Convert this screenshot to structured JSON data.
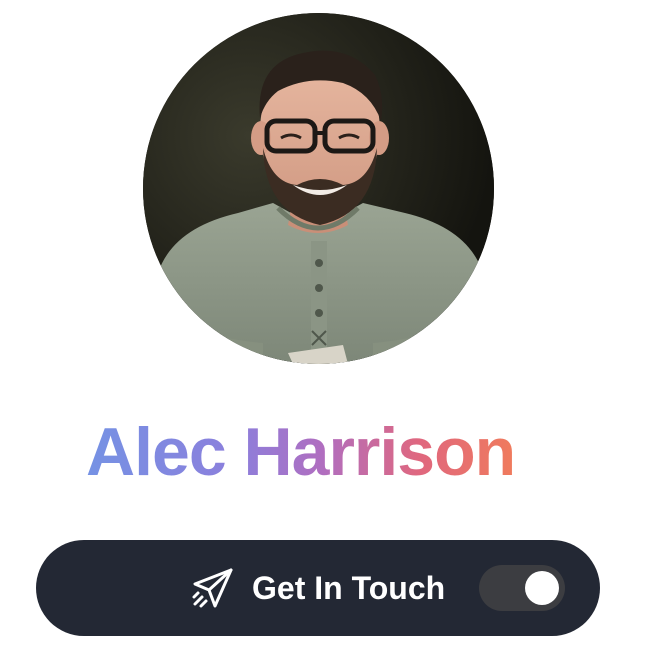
{
  "profile": {
    "name": "Alec Harrison"
  },
  "cta": {
    "label": "Get In Touch",
    "icon": "paper-plane-icon",
    "toggle_on": true
  },
  "colors": {
    "name_gradient": [
      "#7592e4",
      "#8c7fdc",
      "#b06ec0",
      "#e0677e",
      "#f07b5c"
    ],
    "button_bg": "#232834",
    "toggle_track": "#3c3d41",
    "toggle_knob": "#ffffff"
  }
}
